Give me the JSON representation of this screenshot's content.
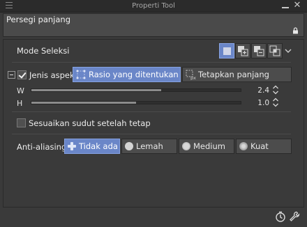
{
  "window": {
    "title": "Properti Tool"
  },
  "tool": {
    "name": "Persegi panjang"
  },
  "selection_mode": {
    "label": "Mode Seleksi",
    "buttons": [
      "new-selection-icon",
      "add-selection-icon",
      "subtract-selection-icon",
      "intersect-selection-icon"
    ],
    "active_index": 0
  },
  "aspect": {
    "label": "Jenis aspek",
    "checked": true,
    "options": [
      {
        "label": "Rasio yang ditentukan",
        "active": true
      },
      {
        "label": "Tetapkan panjang",
        "active": false
      }
    ]
  },
  "ratio": {
    "w": {
      "label": "W",
      "value": "2.4",
      "fraction": 0.62
    },
    "h": {
      "label": "H",
      "value": "1.0",
      "fraction": 0.5
    }
  },
  "adjust_angle": {
    "label": "Sesuaikan sudut setelah tetap",
    "checked": false
  },
  "anti_aliasing": {
    "label": "Anti-aliasing",
    "options": [
      {
        "label": "Tidak ada",
        "active": true
      },
      {
        "label": "Lemah",
        "active": false
      },
      {
        "label": "Medium",
        "active": false
      },
      {
        "label": "Kuat",
        "active": false
      }
    ]
  },
  "colors": {
    "accent": "#6a86c8",
    "panel": "#3a3a3a",
    "button": "#4c4c4c"
  }
}
